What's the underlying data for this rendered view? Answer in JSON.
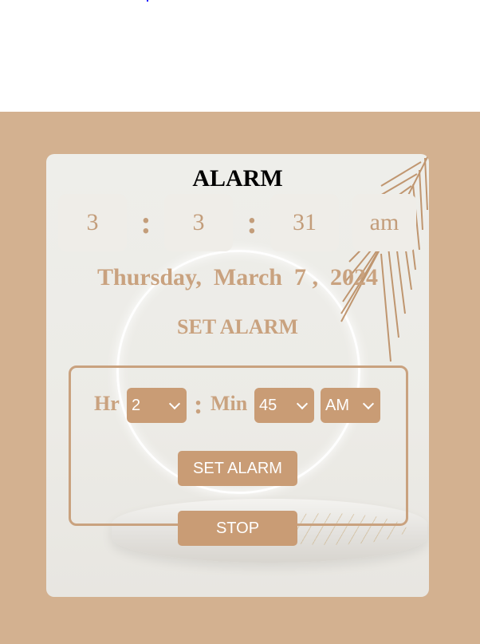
{
  "clock": {
    "title": "ALARM",
    "hours": "3",
    "minutes": "3",
    "seconds": "31",
    "period": "am",
    "separator": ":",
    "date": "Thursday,  March  7 ,  2024"
  },
  "set_alarm": {
    "heading": "SET ALARM",
    "hour_label": "Hr",
    "hour_value": "2",
    "separator": ":",
    "minute_label": "Min",
    "minute_value": "45",
    "period_value": "AM",
    "set_button": "SET ALARM",
    "stop_button": "STOP"
  },
  "colors": {
    "page_background": "#d3b190",
    "accent": "#c99c75",
    "text_accent": "#c9a27f",
    "button_text": "#ffffff"
  },
  "icons": [
    "chevron-down-icon",
    "palm-leaf-decoration",
    "ring-decoration",
    "pedestal-decoration"
  ]
}
